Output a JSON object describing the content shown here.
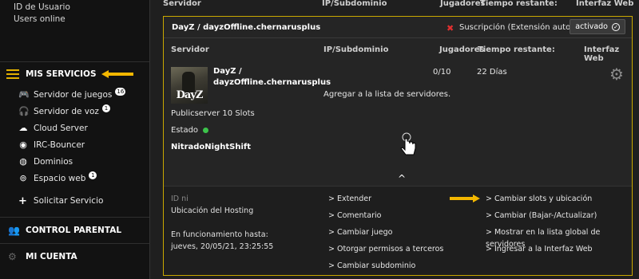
{
  "sidebar": {
    "top_line1": "ID de Usuario",
    "top_line2": "Users online",
    "services_title": "MIS SERVICIOS",
    "items": [
      {
        "label": "Servidor de juegos",
        "badge": "16",
        "icon": "gamepad-icon"
      },
      {
        "label": "Servidor de voz",
        "badge": "1",
        "icon": "headset-icon"
      },
      {
        "label": "Cloud Server",
        "badge": "",
        "icon": "cloud-icon"
      },
      {
        "label": "IRC-Bouncer",
        "badge": "",
        "icon": "radio-icon"
      },
      {
        "label": "Dominios",
        "badge": "",
        "icon": "globe-icon"
      },
      {
        "label": "Espacio web",
        "badge": "1",
        "icon": "webspace-icon"
      }
    ],
    "solicit": "Solicitar Servicio",
    "parental": "CONTROL PARENTAL",
    "account": "MI CUENTA"
  },
  "header": {
    "servidor": "Servidor",
    "ip": "IP/Subdominio",
    "jug": "Jugadores",
    "tiempo": "Tiempo restante:",
    "interfaz": "Interfaz Web"
  },
  "panel": {
    "title": "DayZ / dayzOffline.chernarusplus",
    "subscription": "Suscripción (Extensión automatica)",
    "activated": "activado",
    "col_servidor": "Servidor",
    "col_ip": "IP/Subdominio",
    "col_jug": "Jugadores",
    "col_tiempo": "Tiempo restante:",
    "col_interfaz": "Interfaz Web",
    "game_name_1": "DayZ /",
    "game_name_2": "dayzOffline.chernarusplus",
    "game_logo": "DayZ",
    "add_list": "Agregar a la lista de servidores.",
    "players": "0/10",
    "time_left": "22 Días",
    "publicserver": "Publicserver 10 Slots",
    "estado": "Estado",
    "tag": "NitradoNightShift",
    "caret": "^"
  },
  "detail": {
    "id": "ID ni",
    "location": "Ubicación del Hosting",
    "running_label": "En funcionamiento hasta:",
    "running_date": "jueves, 20/05/21, 23:25:55",
    "col2": [
      "> Extender",
      "> Comentario",
      "> Cambiar juego",
      "> Otorgar permisos a terceros",
      "> Cambiar subdominio"
    ],
    "col3": [
      "> Cambiar slots y ubicación",
      "> Cambiar (Bajar-/Actualizar)",
      "> Mostrar en la lista global de servidores",
      "> Ingresar a la Interfaz Web"
    ]
  },
  "colors": {
    "accent": "#e2b100",
    "arrow": "#f3b700",
    "status_ok": "#3cc34b",
    "cancel": "#e03030"
  }
}
